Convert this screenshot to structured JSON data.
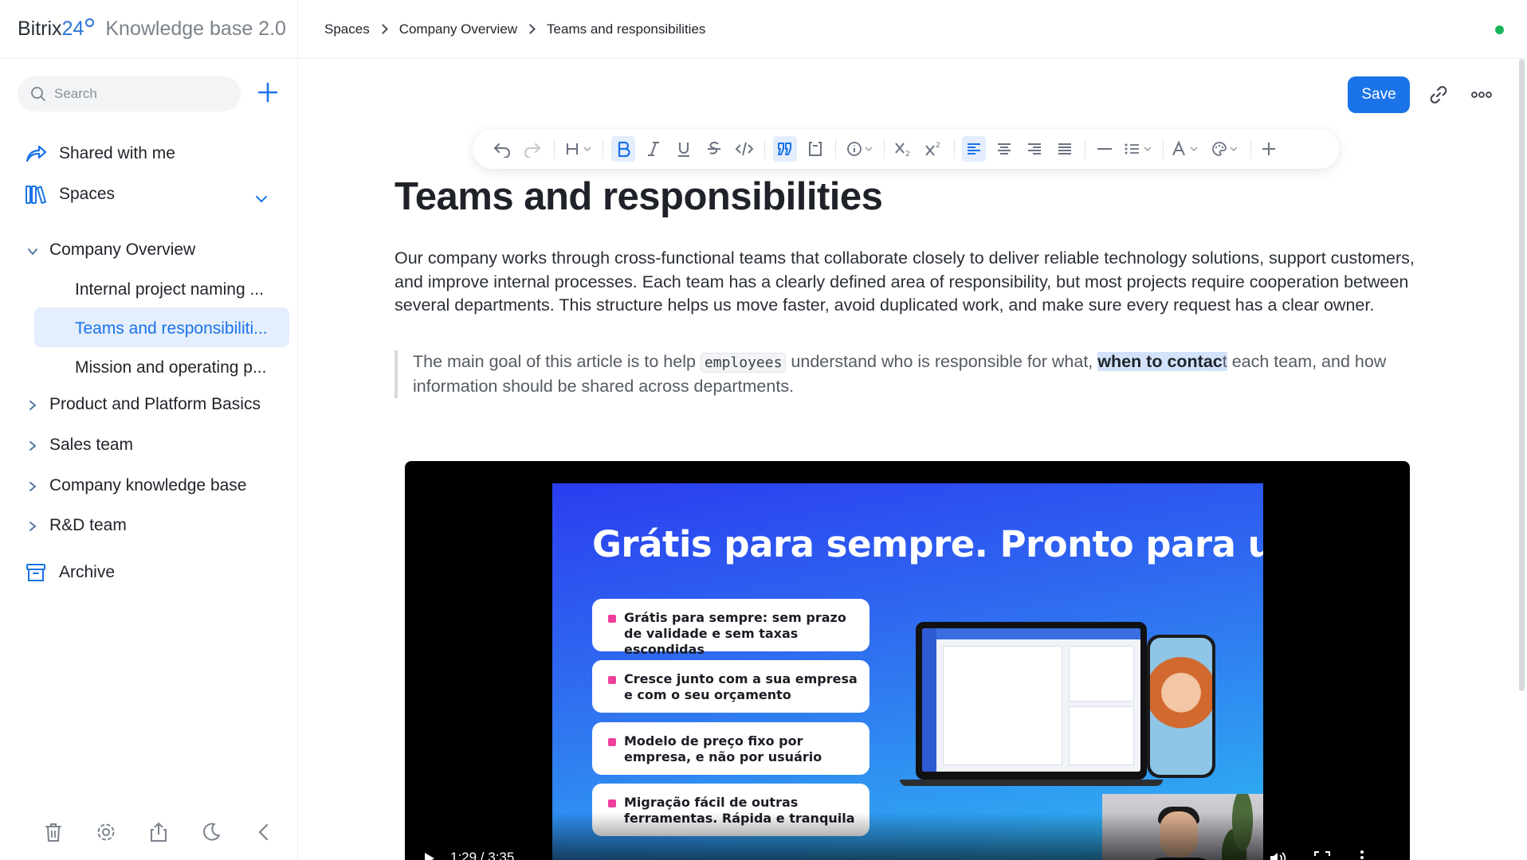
{
  "app": {
    "brand_main": "Bitrix",
    "brand_num": "24",
    "product": "Knowledge base 2.0"
  },
  "breadcrumbs": [
    "Spaces",
    "Company Overview",
    "Teams and responsibilities"
  ],
  "status": {
    "online_color": "#19b35a"
  },
  "sidebar": {
    "search_placeholder": "Search",
    "shared": "Shared with me",
    "spaces": "Spaces",
    "tree": {
      "company_overview": "Company Overview",
      "children": [
        "Internal project naming ...",
        "Teams and responsibiliti...",
        "Mission and operating p..."
      ],
      "active_index": 1,
      "sections": [
        "Product and Platform Basics",
        "Sales team",
        "Company knowledge base",
        "R&D team"
      ]
    },
    "archive": "Archive",
    "bottom_icons": [
      "trash-icon",
      "settings-icon",
      "share-icon",
      "moon-icon",
      "collapse-icon"
    ]
  },
  "editor": {
    "save_label": "Save",
    "toolbar_icons": [
      "undo",
      "redo",
      "heading",
      "bold",
      "italic",
      "underline",
      "strikethrough",
      "code",
      "quote",
      "code-block",
      "info",
      "subscript",
      "superscript",
      "align-left",
      "align-center",
      "align-right",
      "justify",
      "divider",
      "list",
      "text-color",
      "highlight-color",
      "insert"
    ],
    "active_tools": [
      "bold",
      "quote",
      "align-left"
    ],
    "accent_color": "#1a73e8"
  },
  "document": {
    "title": "Teams and responsibilities",
    "paragraph": "Our company works through cross-functional teams that collaborate closely to deliver reliable technology solutions, support customers, and improve internal processes. Each team has a clearly defined area of responsibility, but most projects require cooperation between several departments. This structure helps us move faster, avoid duplicated work, and make sure every request has a clear owner.",
    "quote": {
      "part1": "The main goal of this article is to help ",
      "code": "employees",
      "part2": " understand who is responsible for what, ",
      "highlight_bold": "when to contac",
      "highlight_plain": "t",
      "part3": " each team, and how information should be shared across departments."
    }
  },
  "video": {
    "slide_title": "Grátis para sempre. Pronto para usar.",
    "bullets": [
      "Grátis para sempre: sem prazo de validade e sem taxas escondidas",
      "Cresce junto com a sua empresa e com o seu orçamento",
      "Modelo de preço fixo por empresa, e não por usuário",
      "Migração fácil de outras ferramentas. Rápida e tranquila"
    ],
    "time": "1:29 / 3:35"
  }
}
